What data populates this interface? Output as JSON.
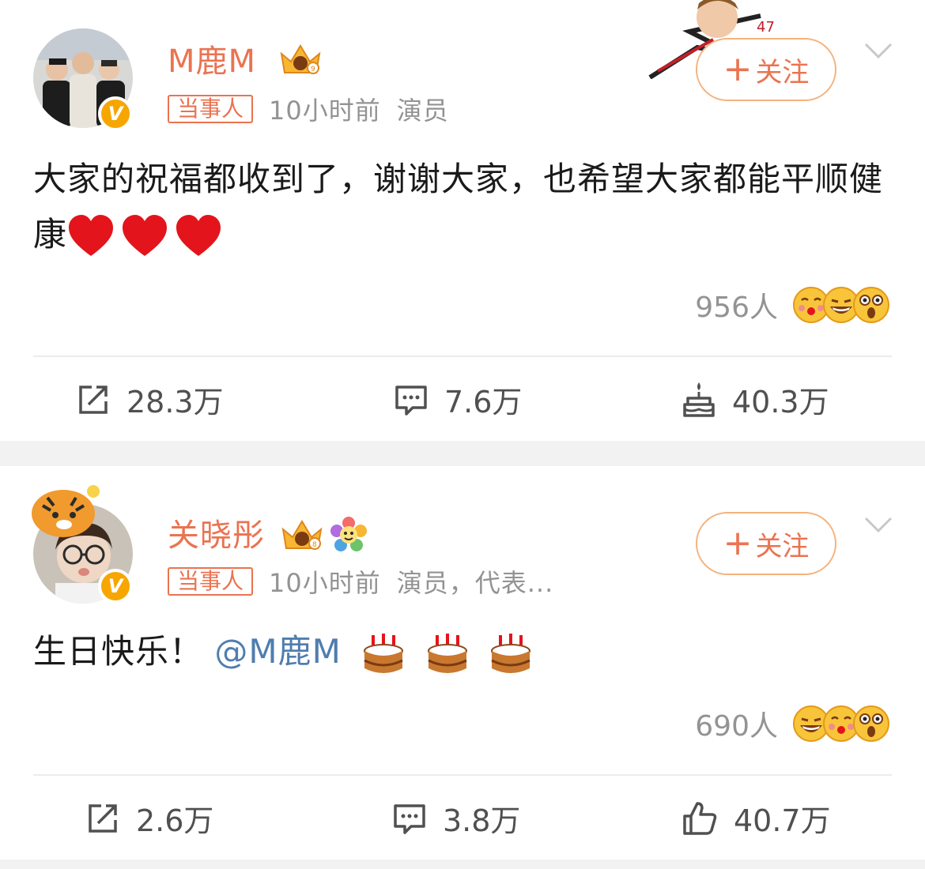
{
  "posts": [
    {
      "username": "M鹿M",
      "tag": "当事人",
      "time": "10小时前",
      "role": "演员",
      "follow_label": "关注",
      "content": "大家的祝福都收到了，谢谢大家，也希望大家都能平顺健康",
      "content_emoji": [
        "heart",
        "heart",
        "heart"
      ],
      "reaction_count": "956人",
      "reaction_faces": [
        "kiss-face",
        "grin-face",
        "surprised-face"
      ],
      "actions": {
        "repost": "28.3万",
        "comment": "7.6万",
        "like": "40.3万"
      },
      "like_icon": "birthday-cake-icon"
    },
    {
      "username": "关晓彤",
      "tag": "当事人",
      "time": "10小时前",
      "role": "演员，代表...",
      "follow_label": "关注",
      "content_prefix": "生日快乐！",
      "mention": "@M鹿M",
      "content_emoji": [
        "cake",
        "cake",
        "cake"
      ],
      "reaction_count": "690人",
      "reaction_faces": [
        "grin-face",
        "kiss-face",
        "surprised-face"
      ],
      "actions": {
        "repost": "2.6万",
        "comment": "3.8万",
        "like": "40.7万"
      },
      "like_icon": "thumbs-up-icon"
    }
  ],
  "colors": {
    "accent": "#eb7350",
    "mention": "#507daf",
    "muted": "#939393",
    "verified": "#f7a600"
  }
}
